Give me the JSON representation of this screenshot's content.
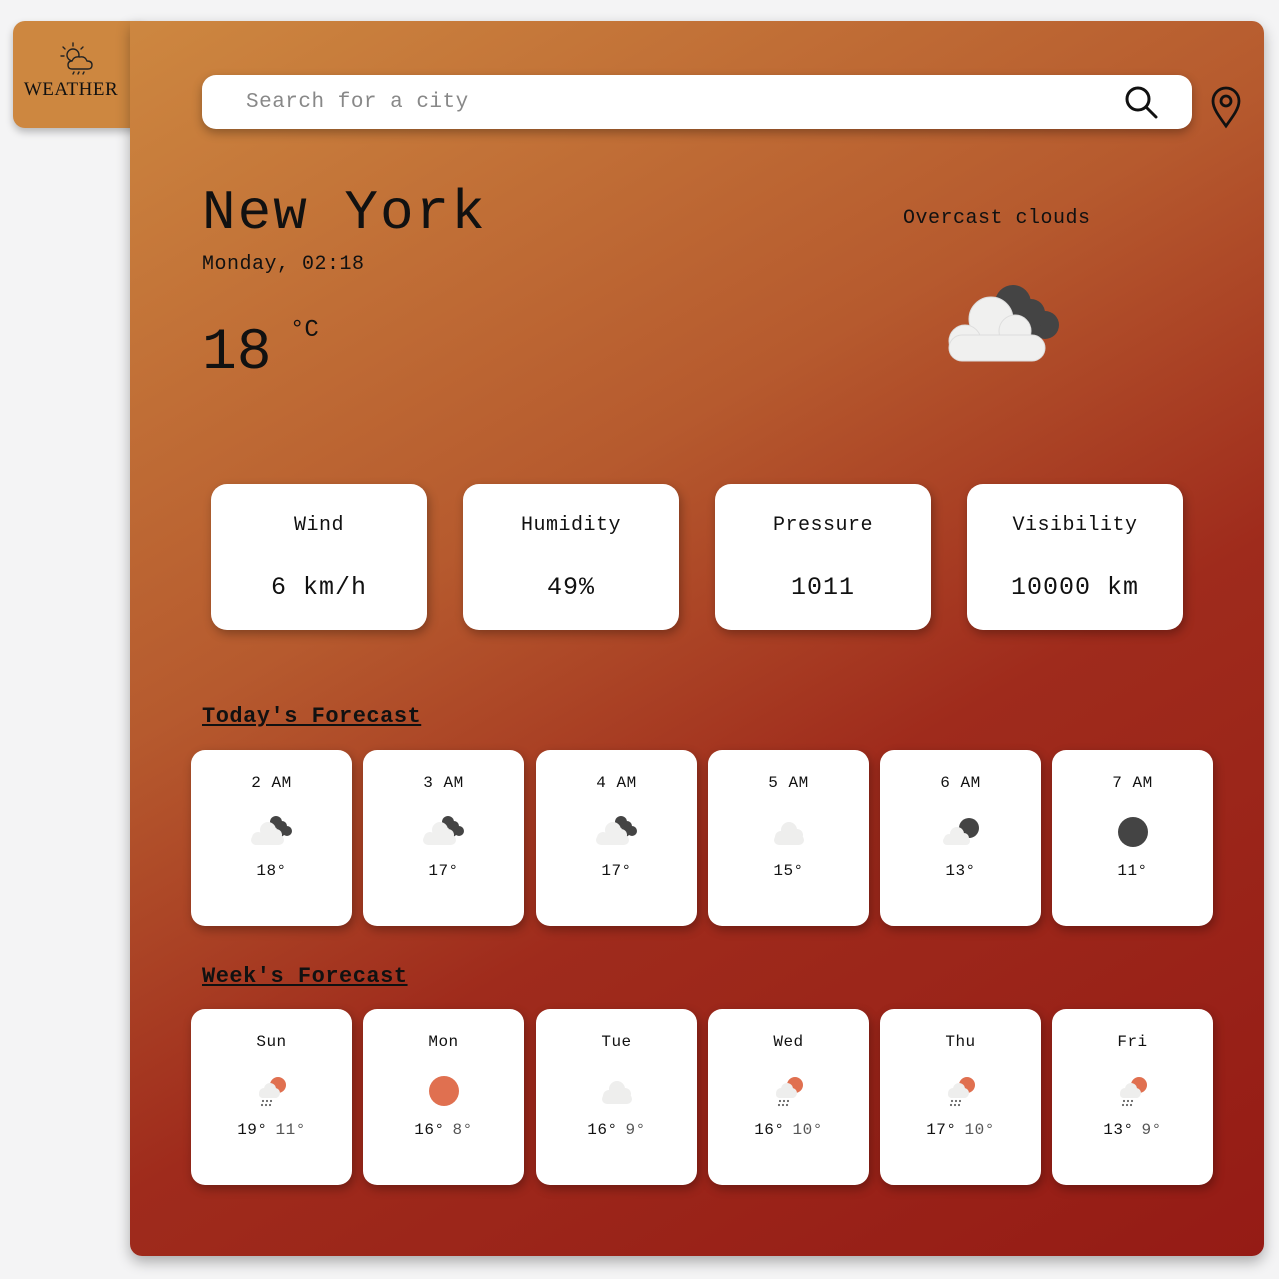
{
  "app": {
    "logo_text": "WEATHER"
  },
  "search": {
    "placeholder": "Search for a city"
  },
  "current": {
    "city": "New York",
    "datetime": "Monday, 02:18",
    "temperature": "18",
    "unit": "°C",
    "condition": "Overcast clouds",
    "icon": "overcast-clouds-icon"
  },
  "stats": [
    {
      "label": "Wind",
      "value": "6 km/h"
    },
    {
      "label": "Humidity",
      "value": "49%"
    },
    {
      "label": "Pressure",
      "value": "1011"
    },
    {
      "label": "Visibility",
      "value": "10000 km"
    }
  ],
  "today": {
    "title": "Today's Forecast",
    "hours": [
      {
        "time": "2 AM",
        "temp": "18°",
        "icon": "broken-clouds-icon"
      },
      {
        "time": "3 AM",
        "temp": "17°",
        "icon": "broken-clouds-icon"
      },
      {
        "time": "4 AM",
        "temp": "17°",
        "icon": "broken-clouds-icon"
      },
      {
        "time": "5 AM",
        "temp": "15°",
        "icon": "cloud-icon"
      },
      {
        "time": "6 AM",
        "temp": "13°",
        "icon": "night-partly-cloudy-icon"
      },
      {
        "time": "7 AM",
        "temp": "11°",
        "icon": "clear-night-icon"
      }
    ]
  },
  "week": {
    "title": "Week's Forecast",
    "days": [
      {
        "day": "Sun",
        "high": "19°",
        "low": "11°",
        "icon": "sun-rain-icon"
      },
      {
        "day": "Mon",
        "high": "16°",
        "low": "8°",
        "icon": "sun-icon"
      },
      {
        "day": "Tue",
        "high": "16°",
        "low": "9°",
        "icon": "cloud-icon"
      },
      {
        "day": "Wed",
        "high": "16°",
        "low": "10°",
        "icon": "sun-rain-icon"
      },
      {
        "day": "Thu",
        "high": "17°",
        "low": "10°",
        "icon": "sun-rain-icon"
      },
      {
        "day": "Fri",
        "high": "13°",
        "low": "9°",
        "icon": "sun-rain-icon"
      }
    ]
  },
  "colors": {
    "gradient_start": "#cd8740",
    "gradient_end": "#951b15",
    "sun": "#e07050",
    "dark_cloud": "#444444",
    "light_cloud": "#f0f0ef"
  }
}
